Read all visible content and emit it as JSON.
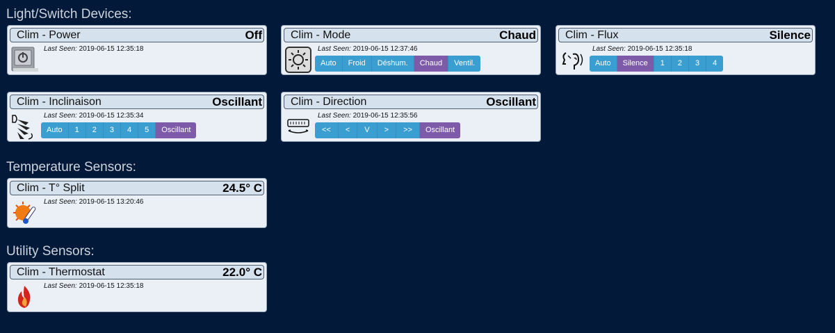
{
  "sections": {
    "switches": "Light/Switch Devices:",
    "temperature": "Temperature Sensors:",
    "utility": "Utility Sensors:"
  },
  "last_seen_label": "Last Seen:",
  "devices": {
    "power": {
      "name": "Clim - Power",
      "status": "Off",
      "last_seen": "2019-06-15 12:35:18",
      "icon": "power-switch-icon"
    },
    "mode": {
      "name": "Clim - Mode",
      "status": "Chaud",
      "last_seen": "2019-06-15 12:37:46",
      "icon": "sun-icon",
      "buttons": [
        "Auto",
        "Froid",
        "Déshum.",
        "Chaud",
        "Ventil."
      ],
      "active": "Chaud"
    },
    "flux": {
      "name": "Clim - Flux",
      "status": "Silence",
      "last_seen": "2019-06-15 12:35:18",
      "icon": "silence-icon",
      "buttons": [
        "Auto",
        "Silence",
        "1",
        "2",
        "3",
        "4"
      ],
      "active": "Silence"
    },
    "inclinaison": {
      "name": "Clim - Inclinaison",
      "status": "Oscillant",
      "last_seen": "2019-06-15 12:35:34",
      "icon": "louver-icon",
      "buttons": [
        "Auto",
        "1",
        "2",
        "3",
        "4",
        "5",
        "Oscillant"
      ],
      "active": "Oscillant"
    },
    "direction": {
      "name": "Clim - Direction",
      "status": "Oscillant",
      "last_seen": "2019-06-15 12:35:56",
      "icon": "air-conditioner-icon",
      "buttons": [
        "<<",
        "<",
        "V",
        ">",
        ">>",
        "Oscillant"
      ],
      "active": "Oscillant"
    },
    "split": {
      "name": "Clim - T° Split",
      "status": "24.5° C",
      "last_seen": "2019-06-15 13:20:46",
      "icon": "thermometer-sun-icon"
    },
    "thermostat": {
      "name": "Clim - Thermostat",
      "status": "22.0° C",
      "last_seen": "2019-06-15 12:35:18",
      "icon": "flame-icon"
    }
  },
  "colors": {
    "background": "#02193a",
    "button": "#3a9ed0",
    "button_active": "#7e5ba8"
  }
}
